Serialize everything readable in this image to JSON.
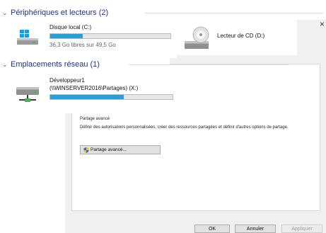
{
  "dialog": {
    "close_glyph": "×",
    "sharing_section_title": "Partage avancé",
    "sharing_description": "Définir des autorisations personnalisées, créer des ressources partagées et définir d'autres options de partage.",
    "advanced_sharing_button": "Partage avancé...",
    "ok_button": "OK",
    "cancel_button": "Annuler",
    "apply_button": "Appliquer"
  },
  "explorer": {
    "groups": [
      {
        "title": "Périphériques et lecteurs (2)",
        "items": [
          {
            "name": "Disque local (C:)",
            "free_text": "36,3 Go libres sur 49,5 Go",
            "usage_fraction": 0.27,
            "icon": "windows-drive-icon"
          },
          {
            "name": "Lecteur de CD (D:)",
            "icon": "cd-drive-icon"
          }
        ]
      },
      {
        "title": "Emplacements réseau (1)",
        "items": [
          {
            "name": "Développeur1",
            "path": "(\\\\WINSERVER2016\\Partages) (X:)",
            "usage_fraction": 0.6,
            "icon": "network-drive-icon"
          }
        ]
      }
    ]
  },
  "colors": {
    "group_header": "#1e3287",
    "usage_fill": "#26a0da"
  }
}
